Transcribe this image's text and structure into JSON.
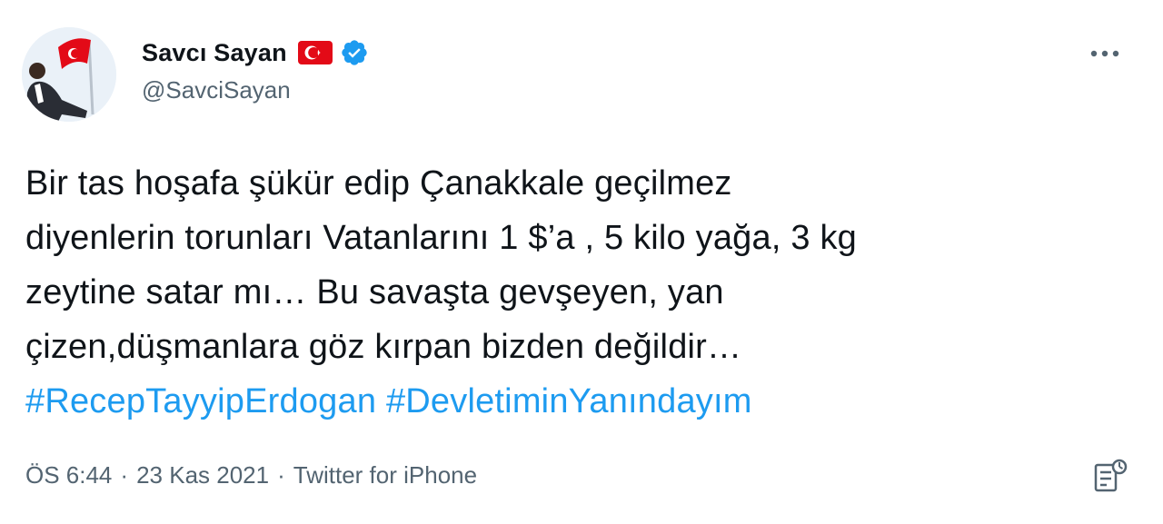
{
  "tweet": {
    "display_name": "Savcı Sayan",
    "handle": "@SavciSayan",
    "flag_icon": "turkey-flag-icon",
    "verified_icon": "verified-badge-icon",
    "more_icon": "more-options-icon",
    "text_lines": [
      "Bir tas hoşafa şükür edip Çanakkale geçilmez",
      "diyenlerin torunları Vatanlarını  1 $’a , 5 kilo yağa, 3 kg",
      "zeytine satar mı… Bu savaşta gevşeyen, yan",
      "çizen,düşmanlara göz kırpan bizden değildir…"
    ],
    "hashtags": [
      "#RecepTayyipErdogan",
      "#DevletiminYanındayım"
    ],
    "time": "ÖS 6:44",
    "date": "23 Kas 2021",
    "source": "Twitter for iPhone",
    "separator": "·",
    "analytics_icon": "tweet-analytics-icon"
  },
  "colors": {
    "text": "#0f1419",
    "secondary": "#536471",
    "link": "#1d9bf0",
    "verified": "#1d9bf0",
    "flag_red": "#e30a17"
  }
}
